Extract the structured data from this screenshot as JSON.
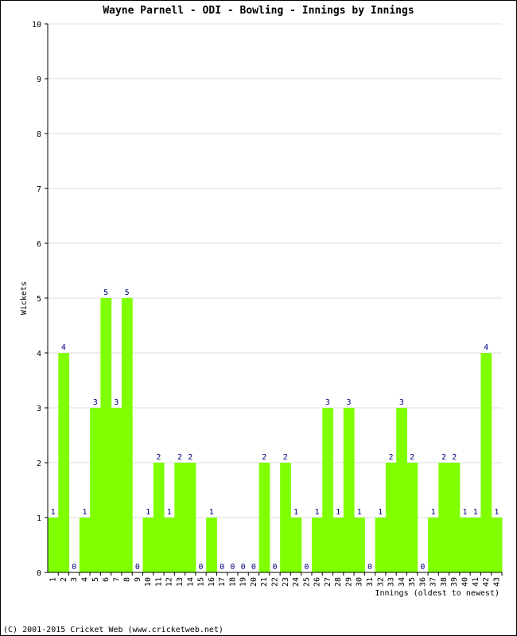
{
  "chart_data": {
    "type": "bar",
    "title": "Wayne Parnell - ODI - Bowling - Innings by Innings",
    "xlabel": "Innings (oldest to newest)",
    "ylabel": "Wickets",
    "ylim": [
      0,
      10
    ],
    "yticks": [
      0,
      1,
      2,
      3,
      4,
      5,
      6,
      7,
      8,
      9,
      10
    ],
    "grid": true,
    "categories": [
      "1",
      "2",
      "3",
      "4",
      "5",
      "6",
      "7",
      "8",
      "9",
      "10",
      "11",
      "12",
      "13",
      "14",
      "15",
      "16",
      "17",
      "18",
      "19",
      "20",
      "21",
      "22",
      "23",
      "24",
      "25",
      "26",
      "27",
      "28",
      "29",
      "30",
      "31",
      "32",
      "33",
      "34",
      "35",
      "36",
      "37",
      "38",
      "39",
      "40",
      "41",
      "42",
      "43"
    ],
    "values": [
      1,
      4,
      0,
      1,
      3,
      5,
      3,
      5,
      0,
      1,
      2,
      1,
      2,
      2,
      0,
      1,
      0,
      0,
      0,
      0,
      2,
      0,
      2,
      1,
      0,
      1,
      3,
      1,
      3,
      1,
      0,
      1,
      2,
      3,
      2,
      0,
      1,
      2,
      2,
      1,
      1,
      4,
      1
    ],
    "colors": {
      "bar": "#80ff00",
      "label": "#000080",
      "grid": "#dddddd",
      "axis": "#000000"
    }
  },
  "footer": "(C) 2001-2015 Cricket Web (www.cricketweb.net)"
}
